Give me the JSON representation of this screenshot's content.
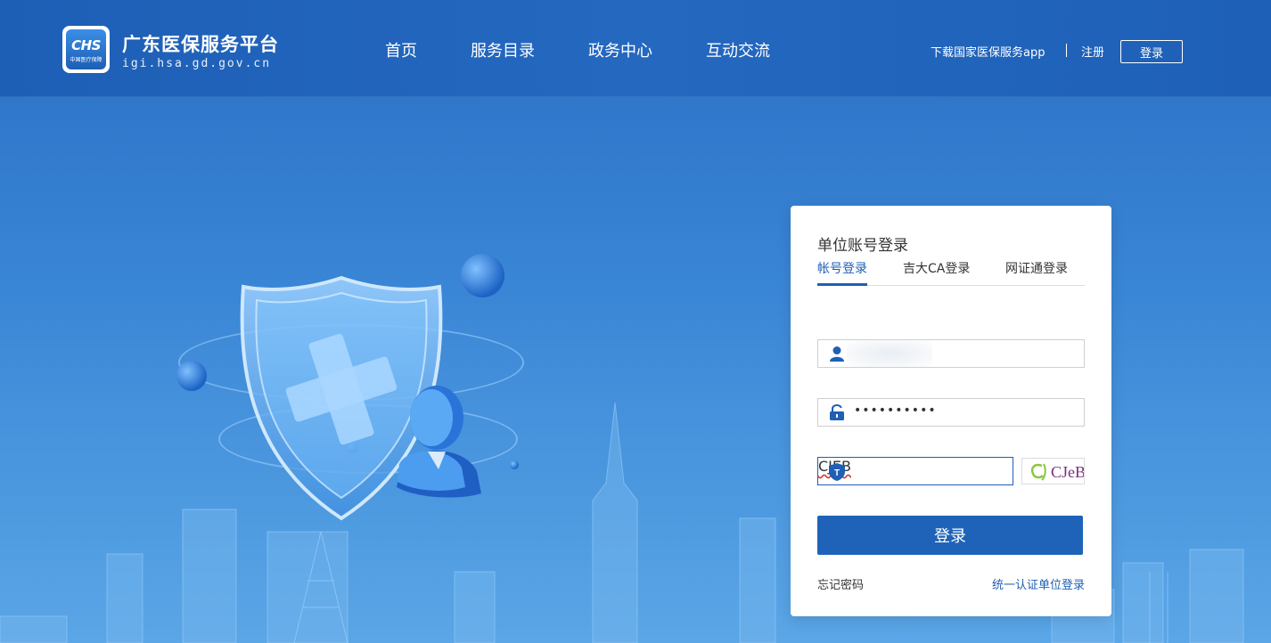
{
  "header": {
    "logo_text": "CHS",
    "logo_subtext": "中国医疗保障",
    "site_title": "广东医保服务平台",
    "site_url": "igi.hsa.gd.gov.cn",
    "nav": [
      "首页",
      "服务目录",
      "政务中心",
      "互动交流"
    ],
    "download_app": "下载国家医保服务app",
    "register": "注册",
    "login": "登录"
  },
  "login_card": {
    "title": "单位账号登录",
    "tabs": [
      "帐号登录",
      "吉大CA登录",
      "网证通登录"
    ],
    "active_tab": "帐号登录",
    "username_value": "",
    "password_value": "••••••••••",
    "captcha_value": "CJEB",
    "captcha_image_text": "CJeB",
    "submit_label": "登录",
    "forgot_password": "忘记密码",
    "unified_login": "统一认证单位登录"
  },
  "colors": {
    "primary": "#1f63b8",
    "header_bg": "#2166bd",
    "link": "#1f5fb5"
  },
  "icons": [
    "user-icon",
    "lock-icon",
    "shield-t-icon",
    "captcha-image"
  ]
}
